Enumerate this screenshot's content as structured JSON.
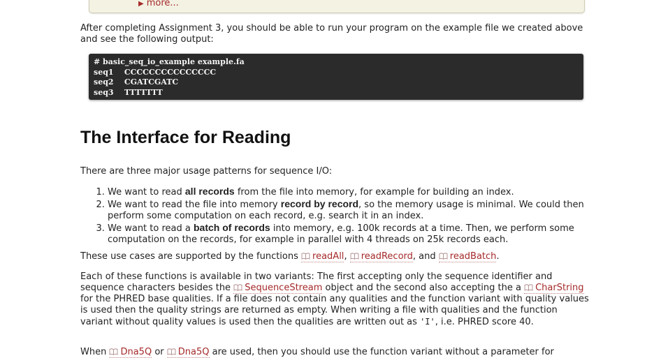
{
  "note": {
    "more_label": "more..."
  },
  "intro": {
    "text": "After completing Assignment 3, you should be able to run your program on the example file we created above and see the following output:"
  },
  "code_output": {
    "lines": [
      "# basic_seq_io_example example.fa",
      "seq1    CCCCCCCCCCCCCCC",
      "seq2    CGATCGATC",
      "seq3    TTTTTTT"
    ]
  },
  "section": {
    "title": "The Interface for Reading",
    "lead": "There are three major usage patterns for sequence I/O:"
  },
  "usage_list": [
    {
      "before": "We want to read ",
      "bold": "all records",
      "after": " from the file into memory, for example for building an index."
    },
    {
      "before": "We want to read the file into memory ",
      "bold": "record by record",
      "after": ", so the memory usage is minimal. We could then perform some computation on each record, e.g. search it in an index."
    },
    {
      "before": "We want to read a ",
      "bold": "batch of records",
      "after": " into memory, e.g. 100k records at a time. Then, we perform some computation on the records, for example in parallel with 4 threads on 25k records each."
    }
  ],
  "functions_para": {
    "prefix": "These use cases are supported by the functions ",
    "fn1": "readAll",
    "sep1": ", ",
    "fn2": "readRecord",
    "sep2": ", and ",
    "fn3": "readBatch",
    "suffix": "."
  },
  "variants_para": {
    "t1": "Each of these functions is available in two variants: The first accepting only the sequence identifier and sequence characters besides the ",
    "ref1": "SequenceStream",
    "t2": " object and the second also accepting the a ",
    "ref2": "CharString",
    "t3": " for the PHRED base qualities. If a file does not contain any qualities and the function variant with quality values is used then the quality strings are returned as empty. When writing a file with qualities and the function variant without quality values is used then the qualities are written out as ",
    "code": "'I'",
    "t4": ", i.e. PHRED score 40."
  },
  "when_para": {
    "t1": "When ",
    "ref1": "Dna5Q",
    "t2": " or ",
    "ref2": "Dna5Q",
    "t3": " are used, then you should use the function variant without a parameter for"
  },
  "colors": {
    "link": "#a52a2a",
    "code_bg": "#2b2b2b",
    "note_bg": "#f3f2e3"
  }
}
